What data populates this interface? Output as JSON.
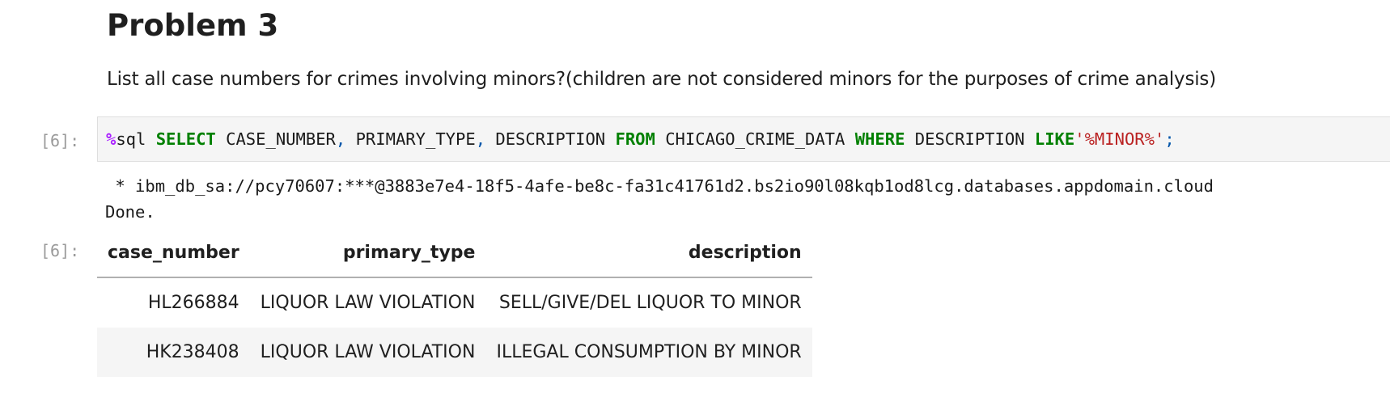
{
  "markdown": {
    "heading": "Problem 3",
    "paragraph": "List all case numbers for crimes involving minors?(children are not considered minors for the purposes of crime analysis)"
  },
  "input_cell": {
    "prompt": "[6]:",
    "code": {
      "magic_symbol": "%",
      "magic_name": "sql ",
      "kw_select": "SELECT",
      "col1": " CASE_NUMBER",
      "comma1": ",",
      "col2": " PRIMARY_TYPE",
      "comma2": ",",
      "col3": " DESCRIPTION ",
      "kw_from": "FROM",
      "table": " CHICAGO_CRIME_DATA ",
      "kw_where": "WHERE",
      "col4": " DESCRIPTION ",
      "kw_like": "LIKE",
      "pattern": "'%MINOR%'",
      "semicolon": ";"
    }
  },
  "output_cell": {
    "prompt": "[6]:",
    "connection": " * ibm_db_sa://pcy70607:***@3883e7e4-18f5-4afe-be8c-fa31c41761d2.bs2io90l08kqb1od8lcg.databases.appdomain.cloud",
    "status": "Done.",
    "table": {
      "headers": [
        "case_number",
        "primary_type",
        "description"
      ],
      "rows": [
        [
          "HL266884",
          "LIQUOR LAW VIOLATION",
          "SELL/GIVE/DEL LIQUOR TO MINOR"
        ],
        [
          "HK238408",
          "LIQUOR LAW VIOLATION",
          "ILLEGAL CONSUMPTION BY MINOR"
        ]
      ]
    }
  },
  "colors": {
    "keyword": "#008000",
    "magic": "#aa22ff",
    "string": "#ba2121",
    "prompt": "#9a9a9a",
    "code_background": "#f5f5f5"
  }
}
